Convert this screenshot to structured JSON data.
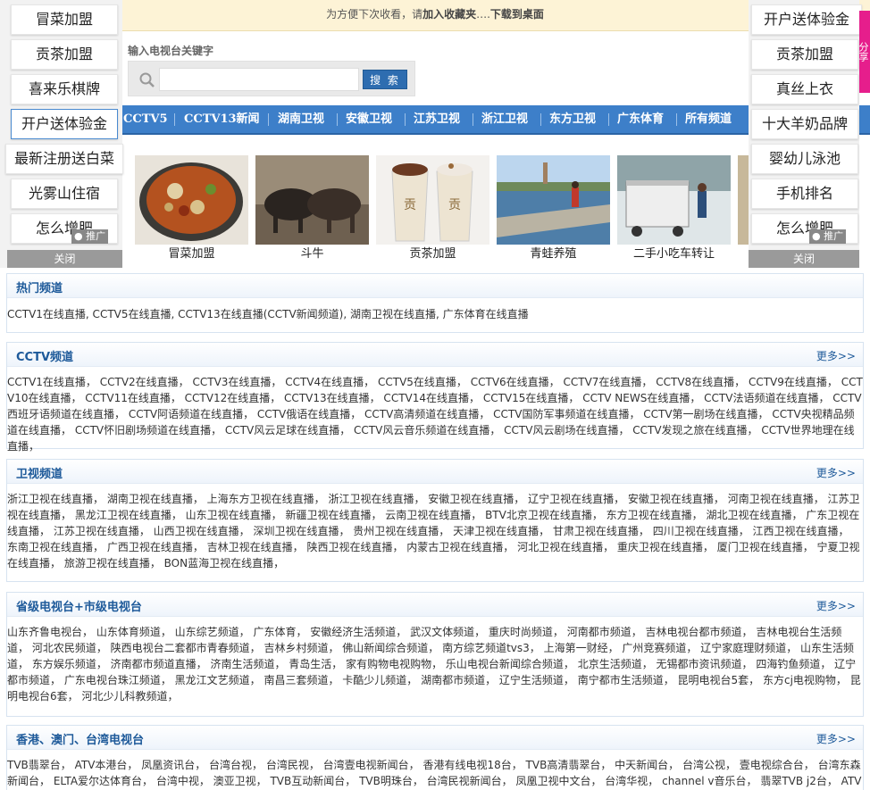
{
  "notice": {
    "prefix": "为方便下次收看，请",
    "bold1": "加入收藏夹",
    "mid": "….",
    "bold2": "下载到桌面"
  },
  "search": {
    "label": "输入电视台关键字",
    "placeholder": "",
    "button": "搜 索"
  },
  "nav": [
    "CCTV5",
    "CCTV13新闻",
    "湖南卫视",
    "安徽卫视",
    "江苏卫视",
    "浙江卫视",
    "东方卫视",
    "广东体育",
    "所有频道"
  ],
  "thumbs": [
    {
      "caption": "冒菜加盟",
      "icon": "food-bowl-image"
    },
    {
      "caption": "斗牛",
      "icon": "bullfight-image"
    },
    {
      "caption": "贡茶加盟",
      "icon": "milk-tea-image"
    },
    {
      "caption": "青蛙养殖",
      "icon": "frog-farm-image"
    },
    {
      "caption": "二手小吃车转让",
      "icon": "food-cart-image"
    }
  ],
  "left_side": {
    "items": [
      "冒菜加盟",
      "贡茶加盟",
      "喜来乐棋牌",
      "开户送体验金",
      "最新注册送白菜",
      "光雾山住宿",
      "怎么增肥"
    ],
    "promo": "推广",
    "close": "关闭"
  },
  "right_side": {
    "items": [
      "开户送体验金",
      "贡茶加盟",
      "真丝上衣",
      "十大羊奶品牌",
      "婴幼儿泳池",
      "手机排名",
      "怎么增肥"
    ],
    "promo": "推广",
    "close": "关闭",
    "tab": "分享"
  },
  "sections": [
    {
      "title": "热门频道",
      "more": "",
      "body": "CCTV1在线直播, CCTV5在线直播, CCTV13在线直播(CCTV新闻频道), 湖南卫视在线直播, 广东体育在线直播"
    },
    {
      "title": "CCTV频道",
      "more": "更多>>",
      "body": "CCTV1在线直播， CCTV2在线直播， CCTV3在线直播， CCTV4在线直播， CCTV5在线直播， CCTV6在线直播， CCTV7在线直播， CCTV8在线直播， CCTV9在线直播， CCTV10在线直播， CCTV11在线直播， CCTV12在线直播， CCTV13在线直播， CCTV14在线直播， CCTV15在线直播， CCTV NEWS在线直播， CCTV法语频道在线直播， CCTV西班牙语频道在线直播， CCTV阿语频道在线直播， CCTV俄语在线直播， CCTV高清频道在线直播， CCTV国防军事频道在线直播， CCTV第一剧场在线直播， CCTV央视精品频道在线直播， CCTV怀旧剧场频道在线直播， CCTV风云足球在线直播， CCTV风云音乐频道在线直播， CCTV风云剧场在线直播， CCTV发现之旅在线直播， CCTV世界地理在线直播，"
    },
    {
      "title": "卫视频道",
      "more": "更多>>",
      "body": "浙江卫视在线直播， 湖南卫视在线直播， 上海东方卫视在线直播， 浙江卫视在线直播， 安徽卫视在线直播， 辽宁卫视在线直播， 安徽卫视在线直播， 河南卫视在线直播， 江苏卫视在线直播， 黑龙江卫视在线直播， 山东卫视在线直播， 新疆卫视在线直播， 云南卫视在线直播， BTV北京卫视在线直播， 东方卫视在线直播， 湖北卫视在线直播， 广东卫视在线直播， 江苏卫视在线直播， 山西卫视在线直播， 深圳卫视在线直播， 贵州卫视在线直播， 天津卫视在线直播， 甘肃卫视在线直播， 四川卫视在线直播， 江西卫视在线直播， 东南卫视在线直播， 广西卫视在线直播， 吉林卫视在线直播， 陕西卫视在线直播， 内蒙古卫视在线直播， 河北卫视在线直播， 重庆卫视在线直播， 厦门卫视在线直播， 宁夏卫视在线直播， 旅游卫视在线直播， BON蓝海卫视在线直播，"
    },
    {
      "title": "省级电视台+市级电视台",
      "more": "更多>>",
      "body": "山东齐鲁电视台， 山东体育频道， 山东综艺频道， 广东体育， 安徽经济生活频道， 武汉文体频道， 重庆时尚频道， 河南都市频道， 吉林电视台都市频道， 吉林电视台生活频道， 河北农民频道， 陕西电视台二套都市青春频道， 吉林乡村频道， 佛山新闻综合频道， 南方综艺频道tvs3， 上海第一财经， 广州竞赛频道， 辽宁家庭理财频道， 山东生活频道， 东方娱乐频道， 济南都市频道直播， 济南生活频道， 青岛生活， 家有购物电视购物， 乐山电视台新闻综合频道， 北京生活频道， 无锡都市资讯频道， 四海钓鱼频道， 辽宁都市频道， 广东电视台珠江频道， 黑龙江文艺频道， 南昌三套频道， 卡酷少儿频道， 湖南都市频道， 辽宁生活频道， 南宁都市生活频道， 昆明电视台5套， 东方cj电视购物， 昆明电视台6套， 河北少儿科教频道，"
    },
    {
      "title": "香港、澳门、台湾电视台",
      "more": "更多>>",
      "body": "TVB翡翠台， ATV本港台， 凤凰资讯台， 台湾台视， 台湾民视， 台湾壹电视新闻台， 香港有线电视18台， TVB高清翡翠台， 中天新闻台， 台湾公视， 壹电视综合台， 台湾东森新闻台， ELTA爱尔达体育台， 台湾中视， 澳亚卫视， TVB互动新闻台， TVB明珠台， 台湾民视新闻台， 凤凰卫视中文台， 台湾华视， channel v音乐台， 翡翠TVB j2台， ATV"
    }
  ]
}
